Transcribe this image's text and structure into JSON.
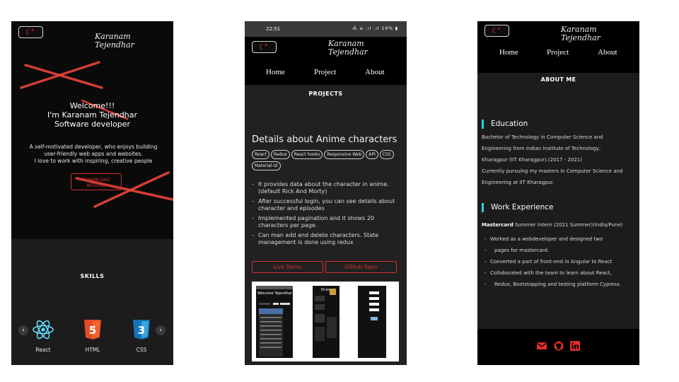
{
  "theme": {
    "accent": "#e0302a",
    "education_bar": "#27d3e0"
  },
  "brand": {
    "name_line1": "Karanam",
    "name_line2": "Tejendhar"
  },
  "nav": {
    "home": "Home",
    "project": "Project",
    "about": "About"
  },
  "home_screen": {
    "welcome_line1": "Welcome!!!",
    "welcome_line2": "I'm Karanam Tejendhar",
    "welcome_line3": "Software developer",
    "intro_line1": "A self-motivated developer, who enjoys building",
    "intro_line2": "user-friendly web apps and websites.",
    "intro_line3": "I love to work with inspiring, creative people",
    "resume_line1": "DOWNLOAD",
    "resume_line2": "RESUME",
    "skills_title": "SKILLS",
    "skills": [
      {
        "label": "React",
        "icon": "react-icon"
      },
      {
        "label": "HTML",
        "icon": "html5-icon"
      },
      {
        "label": "CSS",
        "icon": "css3-icon"
      }
    ]
  },
  "projects_screen": {
    "status_time": "22:51",
    "status_icons": "⁂ ≡ .ıl .ıl 19% ▮",
    "title": "PROJECTS",
    "project_heading": "Details about Anime characters",
    "tags": [
      "React",
      "Redux",
      "React hooks",
      "Responsive Web",
      "API",
      "CSS",
      "Material-UI"
    ],
    "bullets": [
      "It provides data about the character in anime.(default Rick And Morty)",
      "After successful login, you can see details about character and episodes",
      "Implemented pagination and it shows 20 characters per page.",
      "Can man add and delete characters. State management is done using redux"
    ],
    "live_demo": "Live Demo",
    "github_repo": "Github Repo",
    "preview": {
      "heading": "Welcome Tejendhar",
      "title_text": "Enzo"
    }
  },
  "about_screen": {
    "title": "ABOUT ME",
    "education_title": "Education",
    "education_lines": [
      "Bachelor of Technology in Computer Science and",
      "Engineering from Indian Institute of Technology,",
      "Kharagpur (IIT Kharagpur).(2017 - 2021)",
      "Currently pursuing my masters in Computer Science and",
      "Engineering at IIT Kharagpur."
    ],
    "experience_title": "Work Experience",
    "company": "Mastercard",
    "role": "Summer Intern (2021 Summer)(India/Pune)",
    "experience_items": [
      "Worked as a webdeveloper and designed two",
      "pages for mastercard.",
      "Converted a part of front-end in Angular to React",
      "Collaborated with the team to learn about React,",
      "Redux, Bootstapping and testing platform Cypress."
    ],
    "social_icons": [
      "mail-icon",
      "github-icon",
      "linkedin-icon"
    ]
  }
}
